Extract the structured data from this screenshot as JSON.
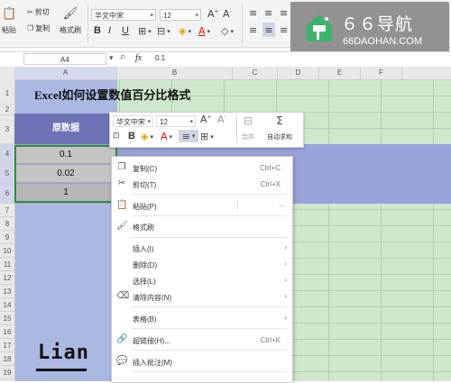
{
  "ribbon": {
    "cut_label": "剪切",
    "copy_label": "复制",
    "paste_label": "粘贴",
    "format_painter_label": "格式刷",
    "font_name": "华文中宋",
    "font_size": "12",
    "bold": "B",
    "italic": "I",
    "underline": "U"
  },
  "watermark": {
    "title": "６６导航",
    "domain": "66DAOHAN.COM"
  },
  "formula_bar": {
    "cell_ref": "A4",
    "fx": "fx",
    "value": "0.1"
  },
  "columns": [
    "A",
    "B",
    "C",
    "D",
    "E",
    "F"
  ],
  "rows": [
    "1",
    "2",
    "3",
    "4",
    "5",
    "6",
    "7",
    "8",
    "9",
    "10",
    "11",
    "12",
    "13",
    "14",
    "15",
    "16",
    "17",
    "18",
    "19"
  ],
  "sheet": {
    "title": "Excel如何设置数值百分比格式",
    "header": "原数据",
    "values": [
      "0.1",
      "0.02",
      "1"
    ]
  },
  "mini_toolbar": {
    "font_name": "华文中宋",
    "font_size": "12",
    "bold": "B",
    "merge_label": "合并",
    "autosum_label": "自动求和"
  },
  "context_menu": {
    "items": [
      {
        "label": "复制(C)",
        "shortcut": "Ctrl+C",
        "icon": "copy-icon",
        "glyph": "❐"
      },
      {
        "label": "剪切(T)",
        "shortcut": "Ctrl+X",
        "icon": "scissors-icon",
        "glyph": "✂"
      },
      {
        "label": "粘贴(P)",
        "shortcut": "",
        "icon": "paste-icon",
        "glyph": "📋"
      },
      {
        "label": "格式刷",
        "shortcut": "",
        "icon": "format-painter-icon",
        "glyph": "🖌"
      },
      {
        "label": "插入(I)",
        "shortcut": "",
        "icon": "",
        "glyph": ""
      },
      {
        "label": "删除(D)",
        "shortcut": "",
        "icon": "",
        "glyph": ""
      },
      {
        "label": "选择(L)",
        "shortcut": "",
        "icon": "",
        "glyph": ""
      },
      {
        "label": "清除内容(N)",
        "shortcut": "",
        "icon": "eraser-icon",
        "glyph": "⌫"
      },
      {
        "label": "表格(B)",
        "shortcut": "",
        "icon": "",
        "glyph": ""
      },
      {
        "label": "超链接(H)...",
        "shortcut": "Ctrl+K",
        "icon": "link-icon",
        "glyph": "🔗"
      },
      {
        "label": "插入批注(M)",
        "shortcut": "",
        "icon": "comment-icon",
        "glyph": "💬"
      }
    ],
    "more": "···"
  },
  "signature": {
    "text": "Lian"
  }
}
